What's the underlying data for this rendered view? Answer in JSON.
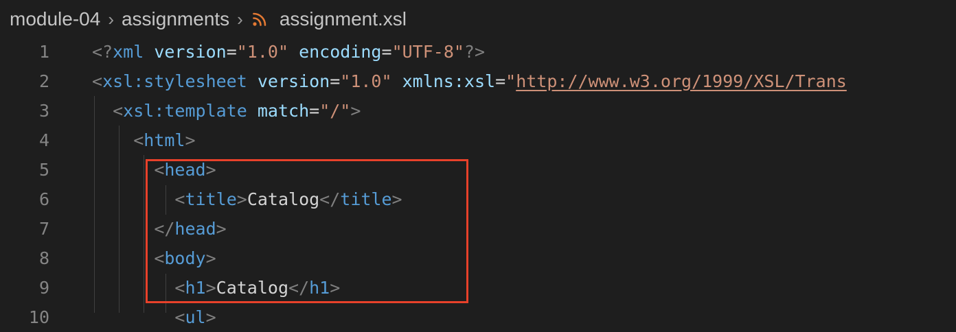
{
  "breadcrumb": {
    "folder1": "module-04",
    "folder2": "assignments",
    "separator": "›",
    "file_icon": "rss-icon",
    "file": "assignment.xsl"
  },
  "colors": {
    "background": "#1e1e1e",
    "tag": "#569cd6",
    "attribute": "#9cdcfe",
    "string": "#ce9178",
    "highlight_box": "#e8412a"
  },
  "editor": {
    "lines": [
      {
        "num": "1",
        "tokens": [
          {
            "t": "br",
            "v": "<?"
          },
          {
            "t": "tag",
            "v": "xml"
          },
          {
            "t": "txt",
            "v": " "
          },
          {
            "t": "attr",
            "v": "version"
          },
          {
            "t": "txt",
            "v": "="
          },
          {
            "t": "str",
            "v": "\"1.0\""
          },
          {
            "t": "txt",
            "v": " "
          },
          {
            "t": "attr",
            "v": "encoding"
          },
          {
            "t": "txt",
            "v": "="
          },
          {
            "t": "str",
            "v": "\"UTF-8\""
          },
          {
            "t": "br",
            "v": "?>"
          }
        ]
      },
      {
        "num": "2",
        "tokens": [
          {
            "t": "br",
            "v": "<"
          },
          {
            "t": "tag",
            "v": "xsl:stylesheet"
          },
          {
            "t": "txt",
            "v": " "
          },
          {
            "t": "attr",
            "v": "version"
          },
          {
            "t": "txt",
            "v": "="
          },
          {
            "t": "str",
            "v": "\"1.0\""
          },
          {
            "t": "txt",
            "v": " "
          },
          {
            "t": "attr",
            "v": "xmlns:xsl"
          },
          {
            "t": "txt",
            "v": "="
          },
          {
            "t": "str",
            "v": "\""
          },
          {
            "t": "url",
            "v": "http://www.w3.org/1999/XSL/Trans"
          }
        ]
      },
      {
        "num": "3",
        "tokens": [
          {
            "t": "txt",
            "v": "  "
          },
          {
            "t": "br",
            "v": "<"
          },
          {
            "t": "tag",
            "v": "xsl:template"
          },
          {
            "t": "txt",
            "v": " "
          },
          {
            "t": "attr",
            "v": "match"
          },
          {
            "t": "txt",
            "v": "="
          },
          {
            "t": "str",
            "v": "\"/\""
          },
          {
            "t": "br",
            "v": ">"
          }
        ]
      },
      {
        "num": "4",
        "tokens": [
          {
            "t": "txt",
            "v": "    "
          },
          {
            "t": "br",
            "v": "<"
          },
          {
            "t": "tag",
            "v": "html"
          },
          {
            "t": "br",
            "v": ">"
          }
        ]
      },
      {
        "num": "5",
        "tokens": [
          {
            "t": "txt",
            "v": "      "
          },
          {
            "t": "br",
            "v": "<"
          },
          {
            "t": "tag",
            "v": "head"
          },
          {
            "t": "br",
            "v": ">"
          }
        ]
      },
      {
        "num": "6",
        "tokens": [
          {
            "t": "txt",
            "v": "        "
          },
          {
            "t": "br",
            "v": "<"
          },
          {
            "t": "tag",
            "v": "title"
          },
          {
            "t": "br",
            "v": ">"
          },
          {
            "t": "txt",
            "v": "Catalog"
          },
          {
            "t": "br",
            "v": "</"
          },
          {
            "t": "tag",
            "v": "title"
          },
          {
            "t": "br",
            "v": ">"
          }
        ]
      },
      {
        "num": "7",
        "tokens": [
          {
            "t": "txt",
            "v": "      "
          },
          {
            "t": "br",
            "v": "</"
          },
          {
            "t": "tag",
            "v": "head"
          },
          {
            "t": "br",
            "v": ">"
          }
        ]
      },
      {
        "num": "8",
        "tokens": [
          {
            "t": "txt",
            "v": "      "
          },
          {
            "t": "br",
            "v": "<"
          },
          {
            "t": "tag",
            "v": "body"
          },
          {
            "t": "br",
            "v": ">"
          }
        ]
      },
      {
        "num": "9",
        "tokens": [
          {
            "t": "txt",
            "v": "        "
          },
          {
            "t": "br",
            "v": "<"
          },
          {
            "t": "tag",
            "v": "h1"
          },
          {
            "t": "br",
            "v": ">"
          },
          {
            "t": "txt",
            "v": "Catalog"
          },
          {
            "t": "br",
            "v": "</"
          },
          {
            "t": "tag",
            "v": "h1"
          },
          {
            "t": "br",
            "v": ">"
          }
        ]
      },
      {
        "num": "10",
        "tokens": [
          {
            "t": "txt",
            "v": "        "
          },
          {
            "t": "br",
            "v": "<"
          },
          {
            "t": "tag",
            "v": "ul"
          },
          {
            "t": "br",
            "v": ">"
          }
        ]
      }
    ]
  }
}
